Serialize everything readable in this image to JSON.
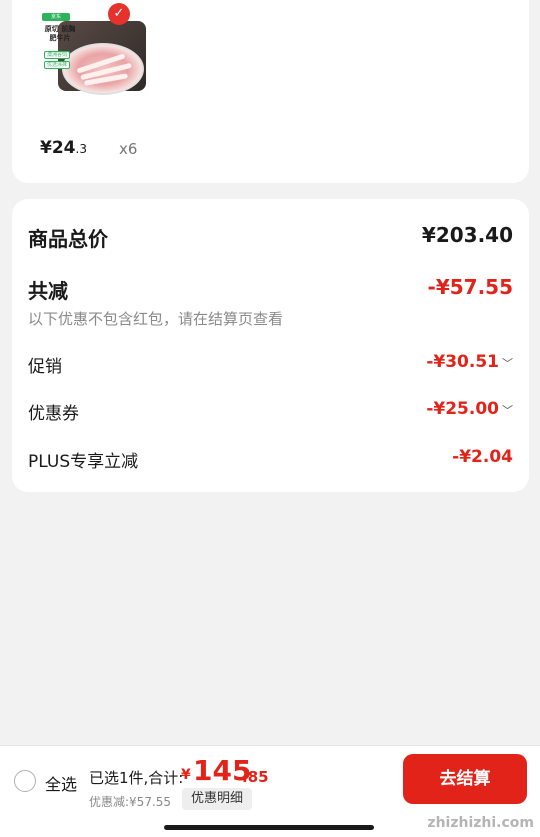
{
  "product": {
    "image_brand": "京东",
    "image_name": "原切 前胸肥牛片",
    "image_tag1": "澳洲谷饲",
    "image_tag2": "优选涂抹",
    "price_int": "¥24",
    "price_dec": ".3",
    "quantity": "x6"
  },
  "summary": {
    "total_label": "商品总价",
    "total_value": "¥203.40",
    "reduce_label": "共减",
    "reduce_value": "-¥57.55",
    "note": "以下优惠不包含红包，请在结算页查看",
    "lines": [
      {
        "label": "促销",
        "value": "-¥30.51",
        "chevron": "chevron-down-icon"
      },
      {
        "label": "优惠券",
        "value": "-¥25.00",
        "chevron": "chevron-down-icon"
      },
      {
        "label": "PLUS专享立减",
        "value": "-¥2.04"
      }
    ]
  },
  "bottom_bar": {
    "select_all": "全选",
    "selected_text": "已选1件,合计:",
    "total_yen": "¥",
    "total_int": "145",
    "total_dec": ".85",
    "discount_text": "优惠减:¥57.55",
    "detail_button": "优惠明细",
    "checkout_button": "去结算"
  },
  "watermark": "zhizhizhi.com",
  "colors": {
    "accent": "#e2231a",
    "background": "#f2f2f2"
  }
}
